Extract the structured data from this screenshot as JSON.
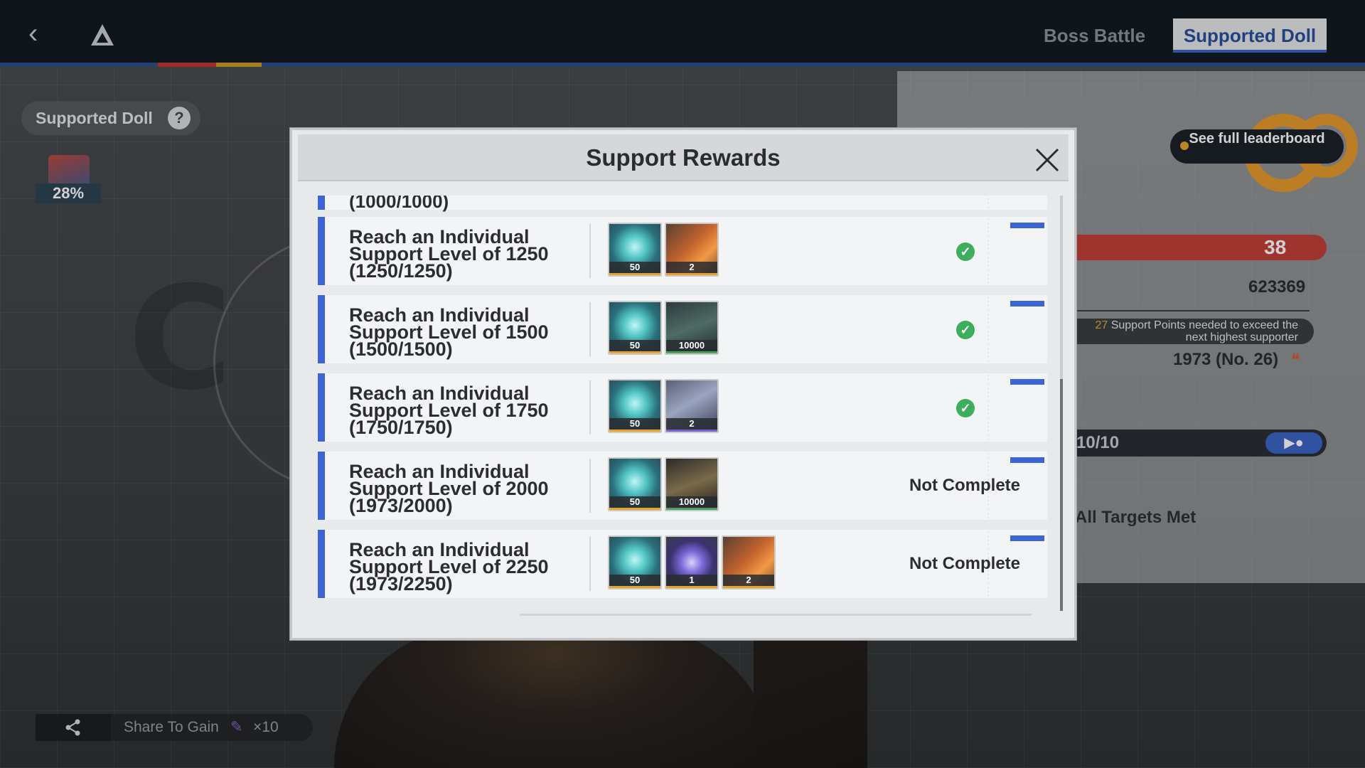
{
  "topbar": {
    "tabs": [
      {
        "label": "Boss Battle",
        "active": false
      },
      {
        "label": "Supported Doll",
        "active": true
      }
    ]
  },
  "left_panel": {
    "supported_doll_label": "Supported Doll",
    "help_label": "?",
    "doll_percent": "28%",
    "share": {
      "label": "Share To Gain",
      "count": "×10"
    }
  },
  "right_panel": {
    "leaderboard_button": "See full leaderboard",
    "rank": "38",
    "score": "623369",
    "hint_points": "27",
    "hint_text": " Support Points needed to exceed the next highest supporter",
    "my_score": "1973 (No. 26)",
    "progress": "10/10",
    "targets": "All Targets Met"
  },
  "modal": {
    "title": "Support Rewards",
    "close_icon": "close-icon",
    "partial_row_text": "(1000/1000)",
    "rows": [
      {
        "title": "Reach an Individual Support Level of 1250 (1250/1250)",
        "rewards": [
          {
            "icon": "gem-icon",
            "qty": "50"
          },
          {
            "icon": "book-icon",
            "qty": "2"
          }
        ],
        "completed": true,
        "status": ""
      },
      {
        "title": "Reach an Individual Support Level of 1500 (1500/1500)",
        "rewards": [
          {
            "icon": "gem-icon",
            "qty": "50"
          },
          {
            "icon": "data-card-icon",
            "qty": "10000"
          }
        ],
        "completed": true,
        "status": ""
      },
      {
        "title": "Reach an Individual Support Level of 1750 (1750/1750)",
        "rewards": [
          {
            "icon": "gem-icon",
            "qty": "50"
          },
          {
            "icon": "chip-icon",
            "qty": "2"
          }
        ],
        "completed": true,
        "status": ""
      },
      {
        "title": "Reach an Individual Support Level of 2000 (1973/2000)",
        "rewards": [
          {
            "icon": "gem-icon",
            "qty": "50"
          },
          {
            "icon": "credit-card-icon",
            "qty": "10000"
          }
        ],
        "completed": false,
        "status": "Not Complete"
      },
      {
        "title": "Reach an Individual Support Level of 2250 (1973/2250)",
        "rewards": [
          {
            "icon": "gem-icon",
            "qty": "50"
          },
          {
            "icon": "orb-icon",
            "qty": "1"
          },
          {
            "icon": "book-icon",
            "qty": "2"
          }
        ],
        "completed": false,
        "status": "Not Complete"
      }
    ]
  },
  "colors": {
    "accent_blue": "#3c64d6",
    "complete_green": "#3cae5c",
    "topbar_bg": "#121b22"
  }
}
